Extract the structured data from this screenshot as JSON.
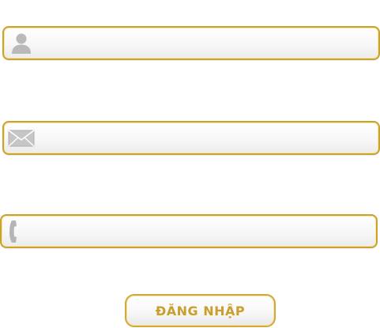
{
  "form": {
    "name_field": {
      "value": "",
      "placeholder": "",
      "icon": "user-icon"
    },
    "email_field": {
      "value": "",
      "placeholder": "",
      "icon": "envelope-icon"
    },
    "phone_field": {
      "value": "",
      "placeholder": "",
      "icon": "phone-icon"
    },
    "submit_label": "ĐĂNG NHẬP"
  },
  "colors": {
    "border_gold": "#c9a230",
    "label_gold": "#c79f32",
    "icon_gray": "#b8b8b8"
  }
}
